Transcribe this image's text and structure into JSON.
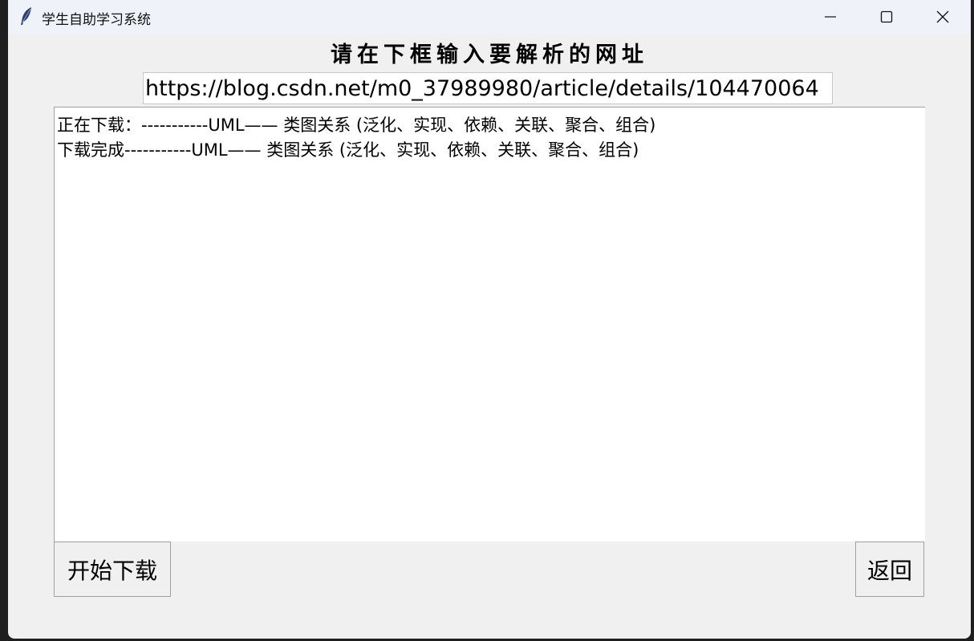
{
  "window": {
    "title": "学生自助学习系统",
    "icon": "feather-icon",
    "controls": [
      "minimize-icon",
      "maximize-icon",
      "close-icon"
    ]
  },
  "main": {
    "prompt": "请在下框输入要解析的网址",
    "url_value": "https://blog.csdn.net/m0_37989980/article/details/104470064",
    "log_lines": [
      "正在下载：-----------UML—— 类图关系 (泛化、实现、依赖、关联、聚合、组合)",
      "下载完成-----------UML—— 类图关系 (泛化、实现、依赖、关联、聚合、组合)"
    ],
    "start_button": "开始下载",
    "back_button": "返回"
  }
}
